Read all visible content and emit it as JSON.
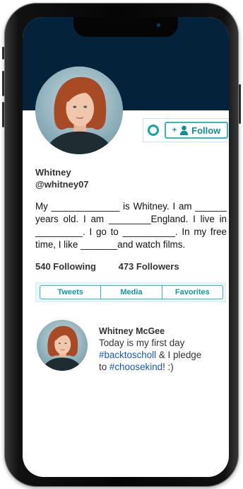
{
  "profile": {
    "name": "Whitney",
    "handle": "@whitney07",
    "follow_label": "Follow",
    "follow_plus": "+"
  },
  "bio": {
    "line1": "My _____________ is Whitney. I am ______",
    "line2": "years old. I am ________England. I live in",
    "line3": "_________. I go to __________. In my free",
    "line4": "time, I like _______and watch films."
  },
  "stats": {
    "following": "540 Following",
    "followers": "473 Followers"
  },
  "tabs": [
    "Tweets",
    "Media",
    "Favorites"
  ],
  "post": {
    "author": "Whitney McGee",
    "text_part1": "Today is my first day",
    "hashtag1": "#backtoscholl",
    "text_part2": " & I pledge",
    "text_part3": "to ",
    "hashtag2": "#choosekind",
    "text_part4": "! :)"
  },
  "colors": {
    "header": "#04223a",
    "accent": "#14a3a7",
    "hashtag": "#1757c4"
  }
}
